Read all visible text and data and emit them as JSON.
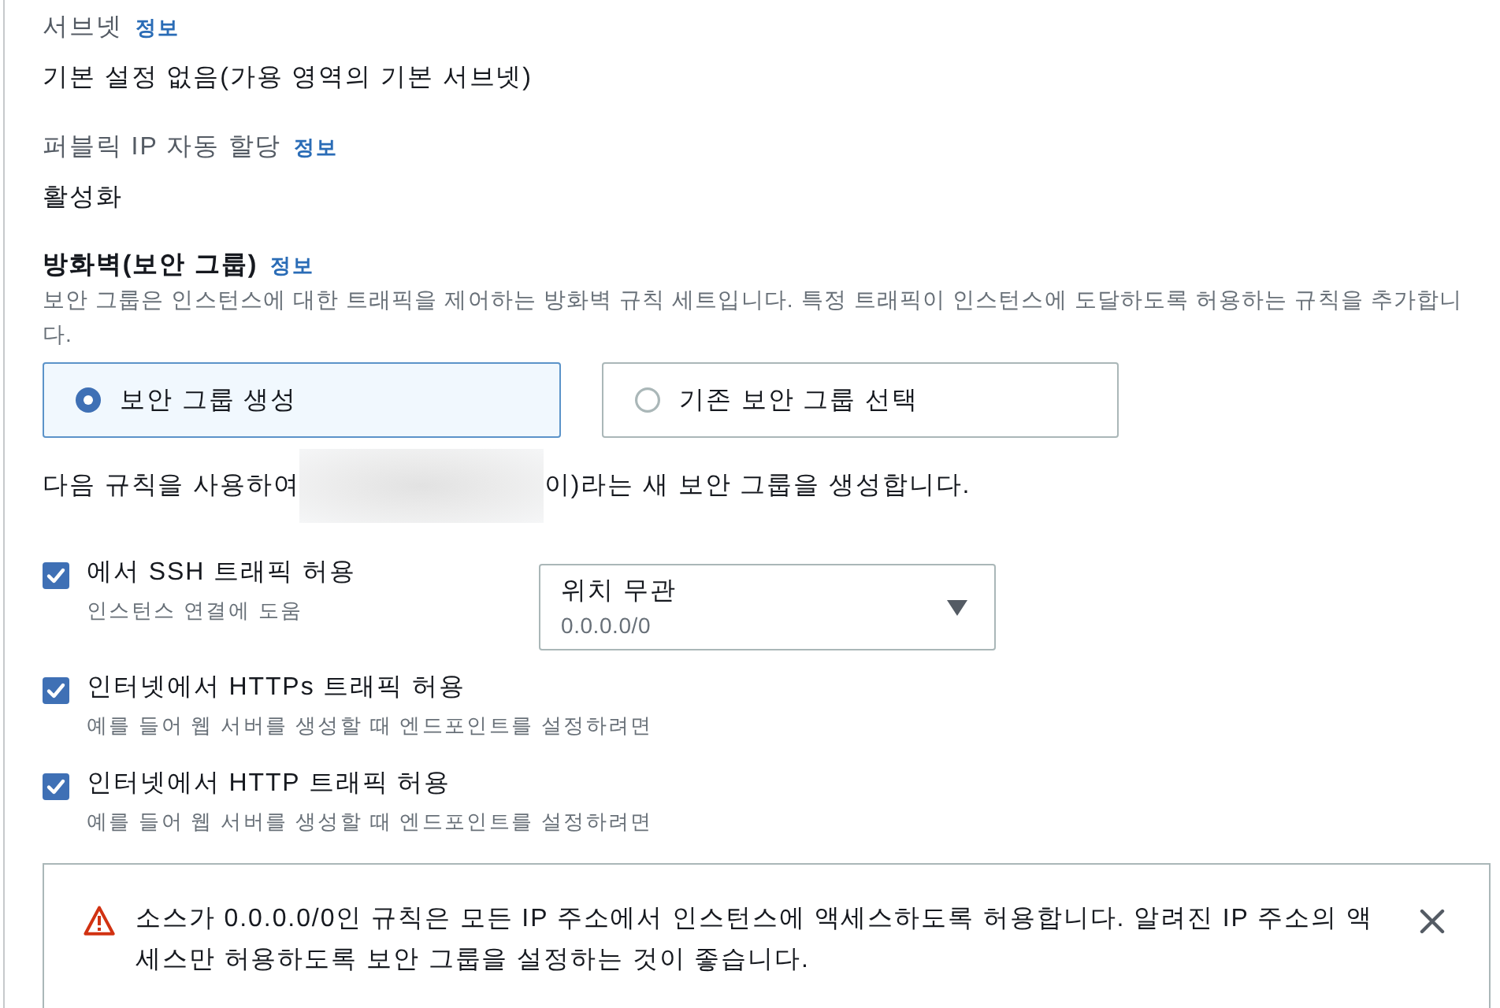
{
  "fields": [
    {
      "label": "서브넷",
      "info": "정보",
      "value": "기본 설정 없음(가용 영역의 기본 서브넷)"
    },
    {
      "label": "퍼블릭 IP 자동 할당",
      "info": "정보",
      "value": "활성화"
    }
  ],
  "firewall": {
    "title": "방화벽(보안 그룹)",
    "info": "정보",
    "description": "보안 그룹은 인스턴스에 대한 트래픽을 제어하는 방화벽 규칙 세트입니다. 특정 트래픽이 인스턴스에 도달하도록 허용하는 규칙을 추가합니다.",
    "options": [
      {
        "label": "보안 그룹 생성",
        "selected": true
      },
      {
        "label": "기존 보안 그룹 선택",
        "selected": false
      }
    ]
  },
  "note": {
    "before": "다음 규칙을 사용하여",
    "redacted": true,
    "after": "이)라는 새 보안 그룹을 생성합니다."
  },
  "rules": [
    {
      "kind": "with_source",
      "label": "에서 SSH 트래픽 허용",
      "hint": "인스턴스 연결에 도움",
      "checked": true,
      "source": {
        "value": "위치 무관",
        "detail": "0.0.0.0/0"
      }
    },
    {
      "kind": "plain",
      "label": "인터넷에서 HTTPs 트래픽 허용",
      "hint": "예를 들어 웹 서버를 생성할 때 엔드포인트를 설정하려면",
      "checked": true
    },
    {
      "kind": "plain",
      "label": "인터넷에서 HTTP 트래픽 허용",
      "hint": "예를 들어 웹 서버를 생성할 때 엔드포인트를 설정하려면",
      "checked": true
    }
  ],
  "alert": {
    "kind": "warning",
    "message": "소스가 0.0.0.0/0인 규칙은 모든 IP 주소에서 인스턴스에 액세스하도록 허용합니다. 알려진 IP 주소의 액세스만 허용하도록 보안 그룹을 설정하는 것이 좋습니다.",
    "dismissible": true
  }
}
